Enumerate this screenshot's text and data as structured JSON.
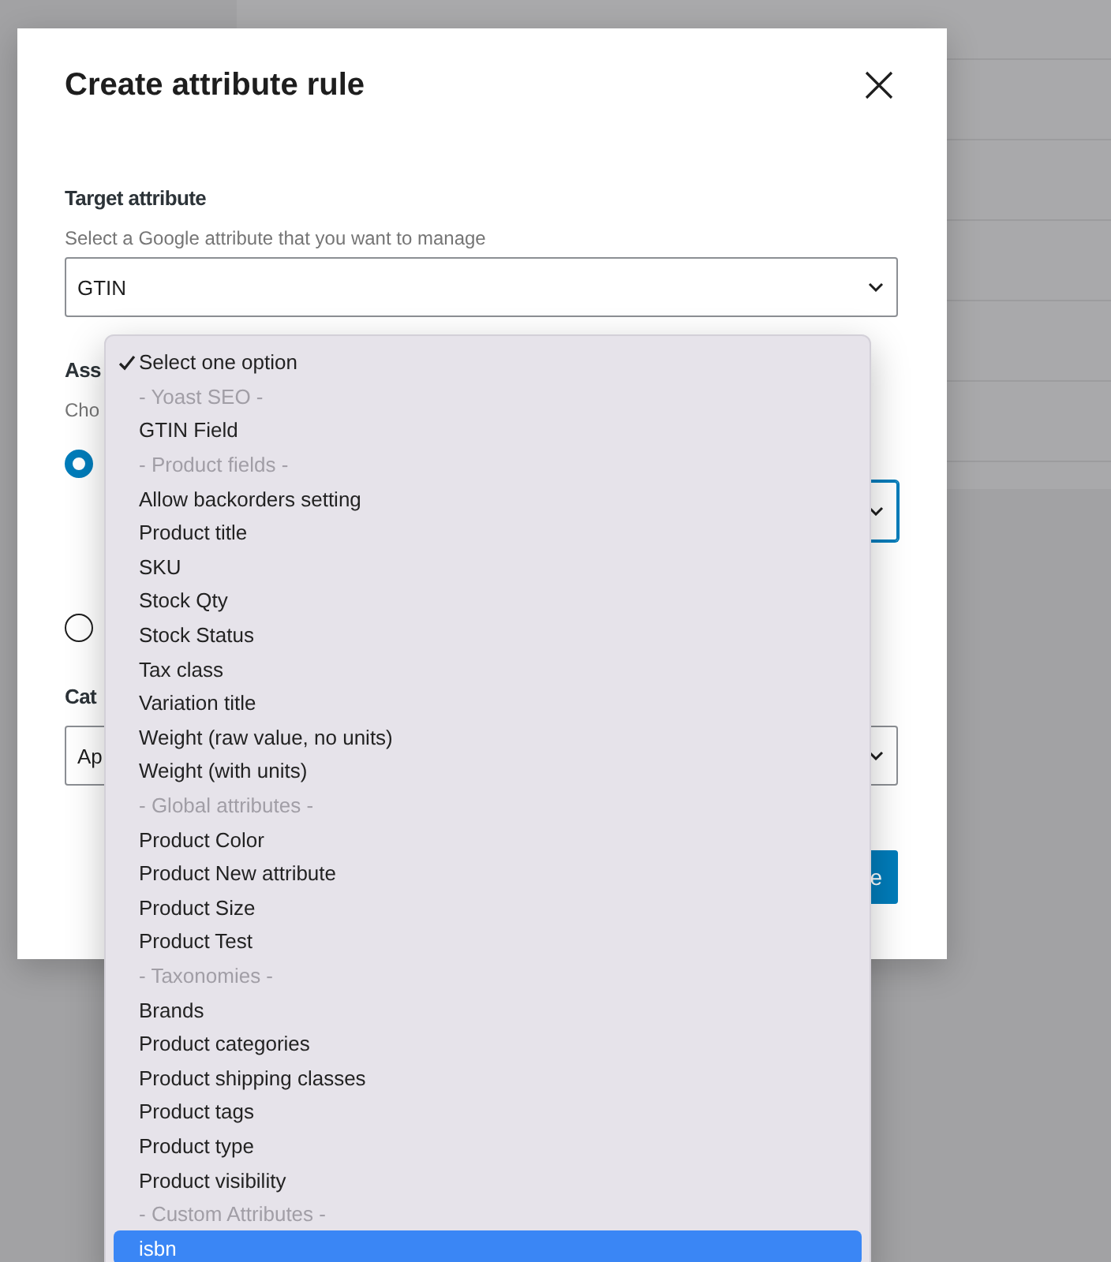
{
  "dialog": {
    "title": "Create attribute rule",
    "target": {
      "label": "Target attribute",
      "help": "Select a Google attribute that you want to manage",
      "value": "GTIN"
    },
    "assign": {
      "label": "Ass",
      "help": "Cho",
      "options": [
        {
          "selected": true
        },
        {
          "selected": false
        }
      ]
    },
    "categories": {
      "label": "Cat",
      "value": "Ap"
    },
    "submit": "e"
  },
  "dropdown": [
    {
      "kind": "option",
      "label": "Select one option",
      "checked": true,
      "selected": false
    },
    {
      "kind": "header",
      "label": "- Yoast SEO -"
    },
    {
      "kind": "option",
      "label": "GTIN Field",
      "checked": false,
      "selected": false
    },
    {
      "kind": "header",
      "label": "- Product fields -"
    },
    {
      "kind": "option",
      "label": "Allow backorders setting",
      "checked": false,
      "selected": false
    },
    {
      "kind": "option",
      "label": "Product title",
      "checked": false,
      "selected": false
    },
    {
      "kind": "option",
      "label": "SKU",
      "checked": false,
      "selected": false
    },
    {
      "kind": "option",
      "label": "Stock Qty",
      "checked": false,
      "selected": false
    },
    {
      "kind": "option",
      "label": "Stock Status",
      "checked": false,
      "selected": false
    },
    {
      "kind": "option",
      "label": "Tax class",
      "checked": false,
      "selected": false
    },
    {
      "kind": "option",
      "label": "Variation title",
      "checked": false,
      "selected": false
    },
    {
      "kind": "option",
      "label": "Weight (raw value, no units)",
      "checked": false,
      "selected": false
    },
    {
      "kind": "option",
      "label": "Weight (with units)",
      "checked": false,
      "selected": false
    },
    {
      "kind": "header",
      "label": "- Global attributes -"
    },
    {
      "kind": "option",
      "label": "Product Color",
      "checked": false,
      "selected": false
    },
    {
      "kind": "option",
      "label": "Product New attribute",
      "checked": false,
      "selected": false
    },
    {
      "kind": "option",
      "label": "Product Size",
      "checked": false,
      "selected": false
    },
    {
      "kind": "option",
      "label": "Product Test",
      "checked": false,
      "selected": false
    },
    {
      "kind": "header",
      "label": "- Taxonomies -"
    },
    {
      "kind": "option",
      "label": "Brands",
      "checked": false,
      "selected": false
    },
    {
      "kind": "option",
      "label": "Product categories",
      "checked": false,
      "selected": false
    },
    {
      "kind": "option",
      "label": "Product shipping classes",
      "checked": false,
      "selected": false
    },
    {
      "kind": "option",
      "label": "Product tags",
      "checked": false,
      "selected": false
    },
    {
      "kind": "option",
      "label": "Product type",
      "checked": false,
      "selected": false
    },
    {
      "kind": "option",
      "label": "Product visibility",
      "checked": false,
      "selected": false
    },
    {
      "kind": "header",
      "label": "- Custom Attributes -"
    },
    {
      "kind": "option",
      "label": "isbn",
      "checked": false,
      "selected": true
    }
  ]
}
